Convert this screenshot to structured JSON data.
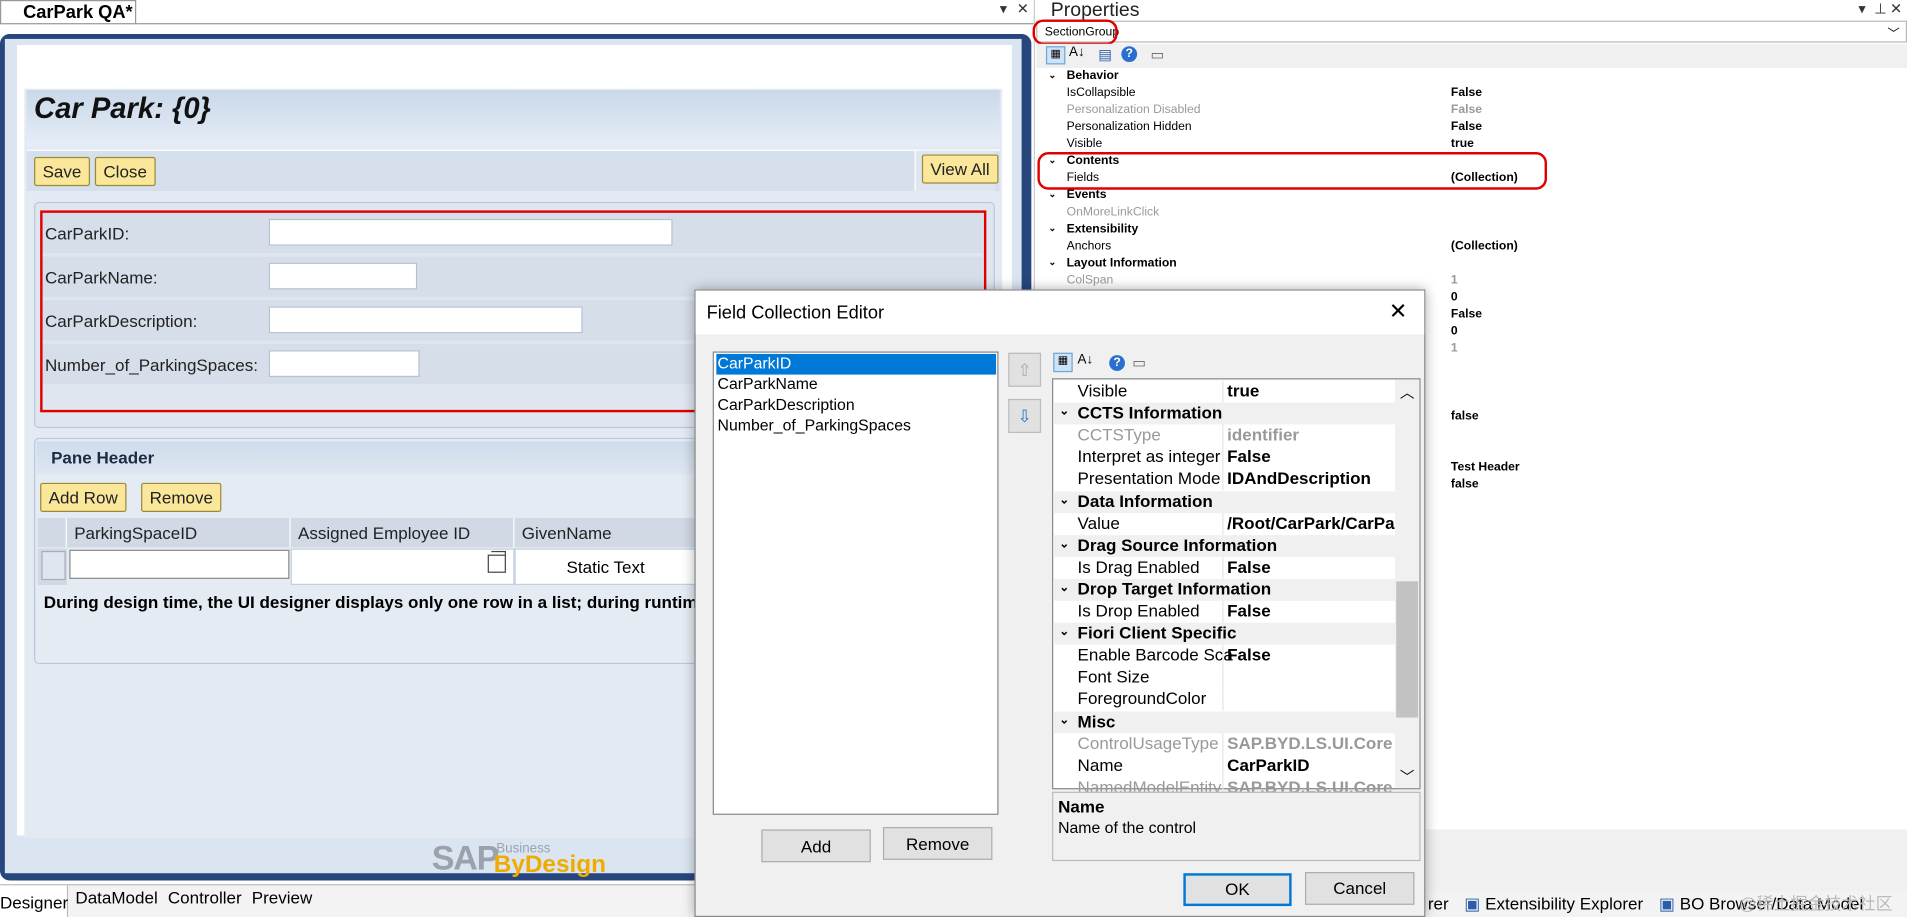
{
  "designer": {
    "tab_title": "CarPark QA*",
    "page_title": "Car Park: {0}",
    "save_label": "Save",
    "close_label": "Close",
    "view_all_label": "View All",
    "fields": [
      {
        "label": "CarParkID:"
      },
      {
        "label": "CarParkName:"
      },
      {
        "label": "CarParkDescription:"
      },
      {
        "label": "Number_of_ParkingSpaces:"
      }
    ],
    "pane_header": "Pane Header",
    "add_row_label": "Add Row",
    "remove_label": "Remove",
    "columns": [
      "ParkingSpaceID",
      "Assigned Employee ID",
      "GivenName"
    ],
    "static_text": "Static Text",
    "note": "During design time, the UI designer displays only one row in a list; during runtime,",
    "sap_logo": "SAP",
    "sap_business": "Business",
    "sap_bydesign": "ByDesign",
    "bottom_tabs": [
      "Designer",
      "DataModel",
      "Controller",
      "Preview"
    ]
  },
  "properties": {
    "title": "Properties",
    "selected_object": "SectionGroup",
    "rows": [
      {
        "type": "cat",
        "name": "Behavior"
      },
      {
        "name": "IsCollapsible",
        "value": "False"
      },
      {
        "name": "Personalization Disabled",
        "value": "False",
        "disabled": true
      },
      {
        "name": "Personalization Hidden",
        "value": "False"
      },
      {
        "name": "Visible",
        "value": "true"
      },
      {
        "type": "cat",
        "name": "Contents"
      },
      {
        "name": "Fields",
        "value": "(Collection)"
      },
      {
        "type": "cat",
        "name": "Events"
      },
      {
        "name": "OnMoreLinkClick",
        "value": "",
        "disabled": true
      },
      {
        "type": "cat",
        "name": "Extensibility"
      },
      {
        "name": "Anchors",
        "value": "(Collection)"
      },
      {
        "type": "cat",
        "name": "Layout Information"
      },
      {
        "name": "ColSpan",
        "value": "1",
        "disabled": true
      },
      {
        "name": "",
        "value": "0"
      },
      {
        "name": "",
        "value": "False"
      },
      {
        "name": "",
        "value": "0"
      },
      {
        "name": "",
        "value": "1",
        "disabled": true
      }
    ],
    "extra_values": [
      {
        "value": "false"
      },
      {
        "value": "Test Header"
      },
      {
        "value": "false"
      }
    ],
    "bottom_tabs": [
      "rer",
      "Extensibility Explorer",
      "BO Browser/Data Model"
    ],
    "watermark": "@稀土掘金技术社区"
  },
  "dialog": {
    "title": "Field Collection Editor",
    "members": [
      "CarParkID",
      "CarParkName",
      "CarParkDescription",
      "Number_of_ParkingSpaces"
    ],
    "selected_member": "CarParkID",
    "add_label": "Add",
    "remove_label": "Remove",
    "grid": [
      {
        "name": "Visible",
        "value": "true"
      },
      {
        "type": "cat",
        "name": "CCTS Information"
      },
      {
        "name": "CCTSType",
        "value": "identifier",
        "disabled": true
      },
      {
        "name": "Interpret as integer",
        "value": "False"
      },
      {
        "name": "Presentation Mode",
        "value": "IDAndDescription"
      },
      {
        "type": "cat",
        "name": "Data Information"
      },
      {
        "name": "Value",
        "value": "/Root/CarPark/CarPa"
      },
      {
        "type": "cat",
        "name": "Drag Source Information"
      },
      {
        "name": "Is Drag Enabled",
        "value": "False"
      },
      {
        "type": "cat",
        "name": "Drop Target Information"
      },
      {
        "name": "Is Drop Enabled",
        "value": "False"
      },
      {
        "type": "cat",
        "name": "Fiori Client Specific"
      },
      {
        "name": "Enable Barcode Sca",
        "value": "False"
      },
      {
        "name": "Font Size",
        "value": ""
      },
      {
        "name": "ForegroundColor",
        "value": ""
      },
      {
        "type": "cat",
        "name": "Misc"
      },
      {
        "name": "ControlUsageType",
        "value": "SAP.BYD.LS.UI.Core",
        "disabled": true
      },
      {
        "name": "Name",
        "value": "CarParkID"
      },
      {
        "name": "NamedModelEntity",
        "value": "SAP.BYD.LS.UI.Core",
        "disabled": true
      }
    ],
    "help_title": "Name",
    "help_text": "Name of the control",
    "ok_label": "OK",
    "cancel_label": "Cancel"
  },
  "colors": {
    "accent": "#0078d7",
    "highlight": "#e10000",
    "yellow_button": "#fae79a"
  }
}
